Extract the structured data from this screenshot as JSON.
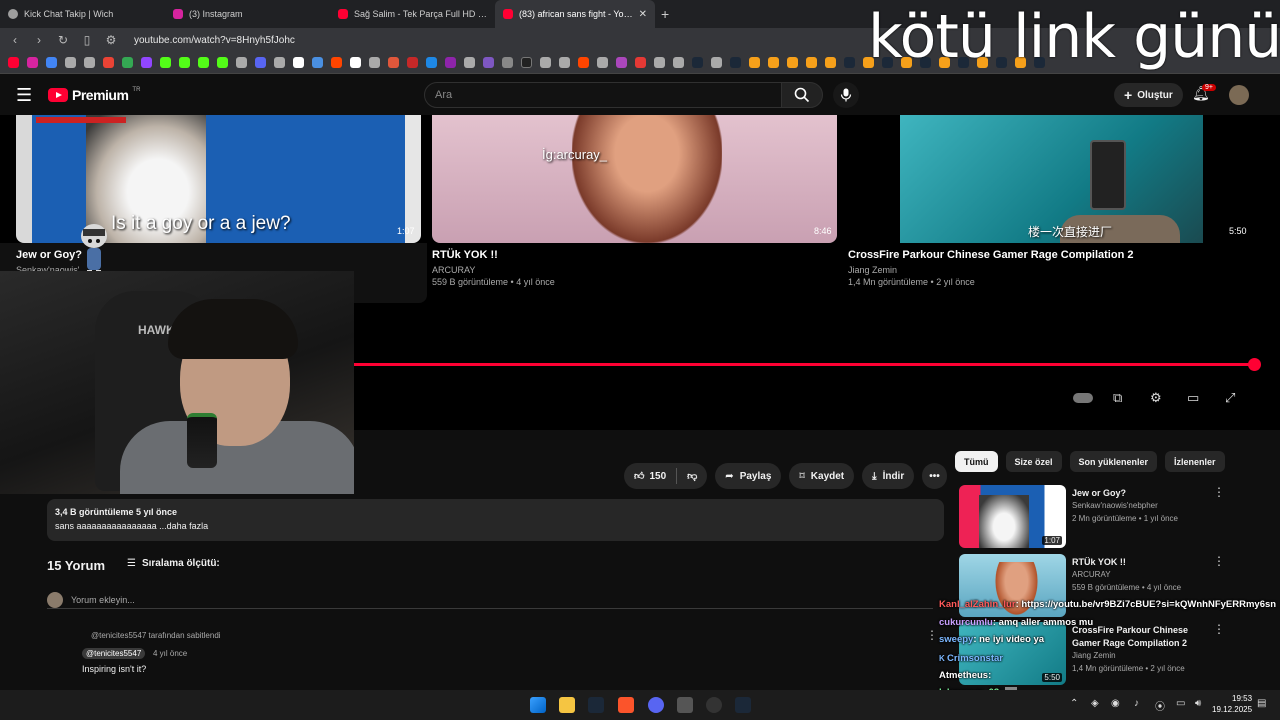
{
  "browser": {
    "tabs": [
      {
        "title": "Kick Chat Takip | Wich",
        "active": false
      },
      {
        "title": "(3) Instagram",
        "active": false
      },
      {
        "title": "Sağ Salim - Tek Parça Full HD (Yerli Fi",
        "active": false
      },
      {
        "title": "(83) african sans fight - YouTube",
        "active": true
      }
    ],
    "url": "youtube.com/watch?v=8Hnyh5fJohc"
  },
  "overlay": {
    "title": "kötü link günü"
  },
  "youtube": {
    "logo": "Premium",
    "logo_region": "TR",
    "search_placeholder": "Ara",
    "create_label": "Oluştur",
    "notifications_badge": "9+"
  },
  "endscreen": [
    {
      "title": "Jew or Goy?",
      "channel": "Senkaw'naowis'",
      "meta": "",
      "duration": "1:07",
      "thumb_caption": "Is it a goy or a a jew?"
    },
    {
      "title": "RTÜk YOK !!",
      "channel": "ARCURAY",
      "meta": "559 B görüntüleme • 4 yıl önce",
      "duration": "8:46",
      "thumb_caption": "İg:arcuray_"
    },
    {
      "title": "CrossFire Parkour Chinese Gamer Rage Compilation 2",
      "channel": "Jiang Zemin",
      "meta": "1,4 Mn görüntüleme • 2 yıl önce",
      "duration": "5:50",
      "thumb_caption": "楼一次直接进厂"
    }
  ],
  "webcam": {
    "chair_brand": "HAWK"
  },
  "actions": {
    "likes": "150",
    "share": "Paylaş",
    "save": "Kaydet",
    "download": "İndir"
  },
  "description": {
    "stats": "3,4 B görüntüleme  5 yıl önce",
    "text": "sans aaaaaaaaaaaaaaaa ...daha fazla"
  },
  "comments": {
    "count": "15 Yorum",
    "sort_label": "Sıralama ölçütü:",
    "add_placeholder": "Yorum ekleyin...",
    "pinned_by": "@tenicites5547 tarafından sabitlendi",
    "first": {
      "author": "@tenicites5547",
      "time": "4 yıl önce",
      "text": "Inspiring isn't it?"
    }
  },
  "chips": [
    "Tümü",
    "Size özel",
    "Son yüklenenler",
    "İzlenenler"
  ],
  "related": [
    {
      "title": "Jew or Goy?",
      "channel": "Senkaw'naowis'nebpher",
      "meta": "2 Mn görüntüleme • 1 yıl önce",
      "duration": "1:07"
    },
    {
      "title": "RTÜk YOK !!",
      "channel": "ARCURAY",
      "meta": "559 B görüntüleme • 4 yıl önce",
      "duration": ""
    },
    {
      "title": "CrossFire Parkour Chinese Gamer Rage Compilation 2",
      "channel": "Jiang Zemin",
      "meta": "1,4 Mn görüntüleme • 2 yıl önce",
      "duration": "5:50"
    }
  ],
  "chat": [
    {
      "user": "Kanl_alZahin_lur",
      "msg": ": https://youtu.be/vr9BZi7cBUE?si=kQWnhNFyERRmy6sn"
    },
    {
      "user": "cukurcumlu",
      "msg": ": amq aller ammos mu"
    },
    {
      "user": "sweepy",
      "msg": ": ne iyi video ya"
    },
    {
      "user": "Crimsonstar",
      "msg": ""
    },
    {
      "user": "Atmetheus",
      "msg": ":"
    },
    {
      "user": "lahmacun_03",
      "msg": ":"
    },
    {
      "user": "lahmacun_03",
      "msg": ":"
    }
  ],
  "taskbar": {
    "time": "19:53",
    "date": "19.12.2025"
  }
}
